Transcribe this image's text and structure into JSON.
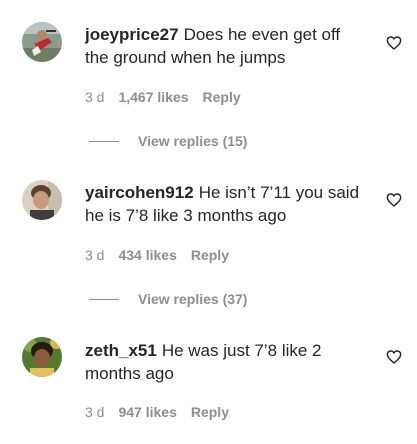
{
  "comments": [
    {
      "username": "joeyprice27",
      "text": "Does he even get off the ground when he jumps",
      "time": "3 d",
      "likes": "1,467 likes",
      "reply": "Reply",
      "view_replies": "View replies (15)"
    },
    {
      "username": "yaircohen912",
      "text": "He isn’t 7’11 you said he is 7’8 like 3 months ago",
      "time": "3 d",
      "likes": "434 likes",
      "reply": "Reply",
      "view_replies": "View replies (37)"
    },
    {
      "username": "zeth_x51",
      "text": "He was just 7’8 like 2 months ago",
      "time": "3 d",
      "likes": "947 likes",
      "reply": "Reply"
    }
  ],
  "icons": {
    "like": "heart-outline-icon"
  },
  "colors": {
    "text": "#262626",
    "secondary": "#8e8e8e",
    "background": "#ffffff"
  }
}
